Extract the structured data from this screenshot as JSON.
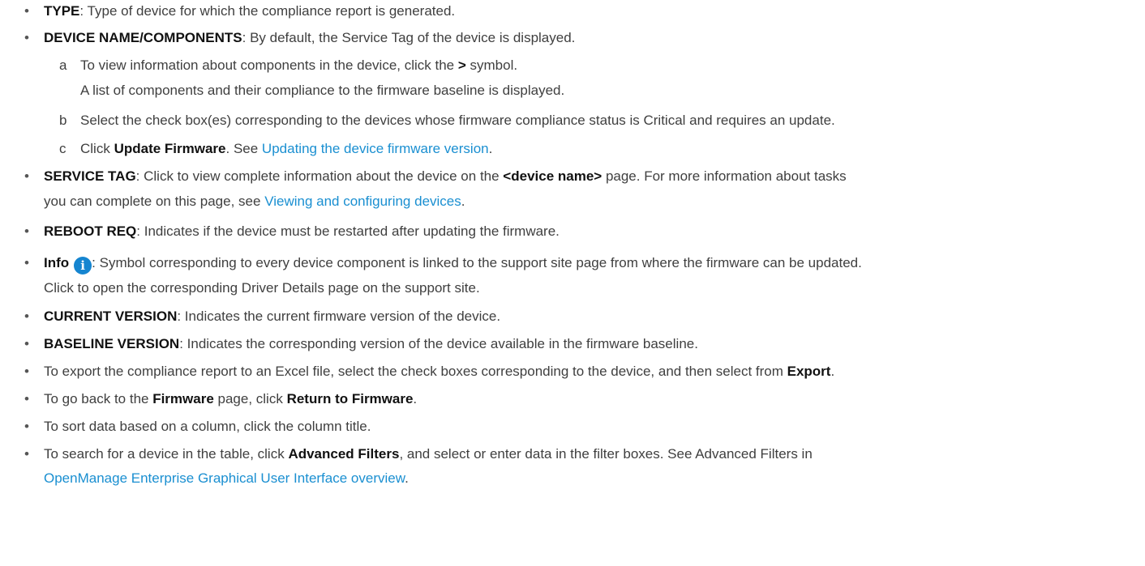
{
  "items": {
    "type": {
      "term": "TYPE",
      "text": ": Type of device for which the compliance report is generated."
    },
    "device_name": {
      "term": "DEVICE NAME/COMPONENTS",
      "text": ": By default, the Service Tag of the device is displayed."
    },
    "steps": {
      "a": {
        "label": "a",
        "pre": "To view information about components in the device, click the ",
        "symbol": ">",
        "post": " symbol.",
        "result": "A list of components and their compliance to the firmware baseline is displayed."
      },
      "b": {
        "label": "b",
        "text": "Select the check box(es) corresponding to the devices whose firmware compliance status is Critical and requires an update."
      },
      "c": {
        "label": "c",
        "pre": "Click ",
        "bold": "Update Firmware",
        "mid": ". See ",
        "link": "Updating the device firmware version",
        "post": "."
      }
    },
    "service_tag": {
      "term": "SERVICE TAG",
      "pre": ": Click to view complete information about the device on the ",
      "bold": "<device name>",
      "post": " page. For more information about tasks",
      "line2_pre": "you can complete on this page, see ",
      "line2_link": "Viewing and configuring devices",
      "line2_post": "."
    },
    "reboot": {
      "term": "REBOOT REQ",
      "text": ": Indicates if the device must be restarted after updating the firmware."
    },
    "info": {
      "term": "Info",
      "icon": "info-icon",
      "icon_glyph": "i",
      "text": ": Symbol corresponding to every device component is linked to the support site page from where the firmware can be updated.",
      "line2": "Click to open the corresponding Driver Details page on the support site."
    },
    "current_version": {
      "term": "CURRENT VERSION",
      "text": ": Indicates the current firmware version of the device."
    },
    "baseline_version": {
      "term": "BASELINE VERSION",
      "text": ": Indicates the corresponding version of the device available in the firmware baseline."
    },
    "export": {
      "pre": "To export the compliance report to an Excel file, select the check boxes corresponding to the device, and then select from ",
      "bold": "Export",
      "post": "."
    },
    "return": {
      "pre": "To go back to the ",
      "bold1": "Firmware",
      "mid": " page, click ",
      "bold2": "Return to Firmware",
      "post": "."
    },
    "sort": {
      "text": "To sort data based on a column, click the column title."
    },
    "search": {
      "pre": "To search for a device in the table, click ",
      "bold": "Advanced Filters",
      "post": ", and select or enter data in the filter boxes. See Advanced Filters in",
      "line2_link": "OpenManage Enterprise Graphical User Interface overview",
      "line2_post": "."
    }
  },
  "bullet_char": "•",
  "colors": {
    "text": "#3f3f3f",
    "bold": "#111111",
    "link": "#1a8fd1",
    "info_icon": "#1585d0"
  }
}
